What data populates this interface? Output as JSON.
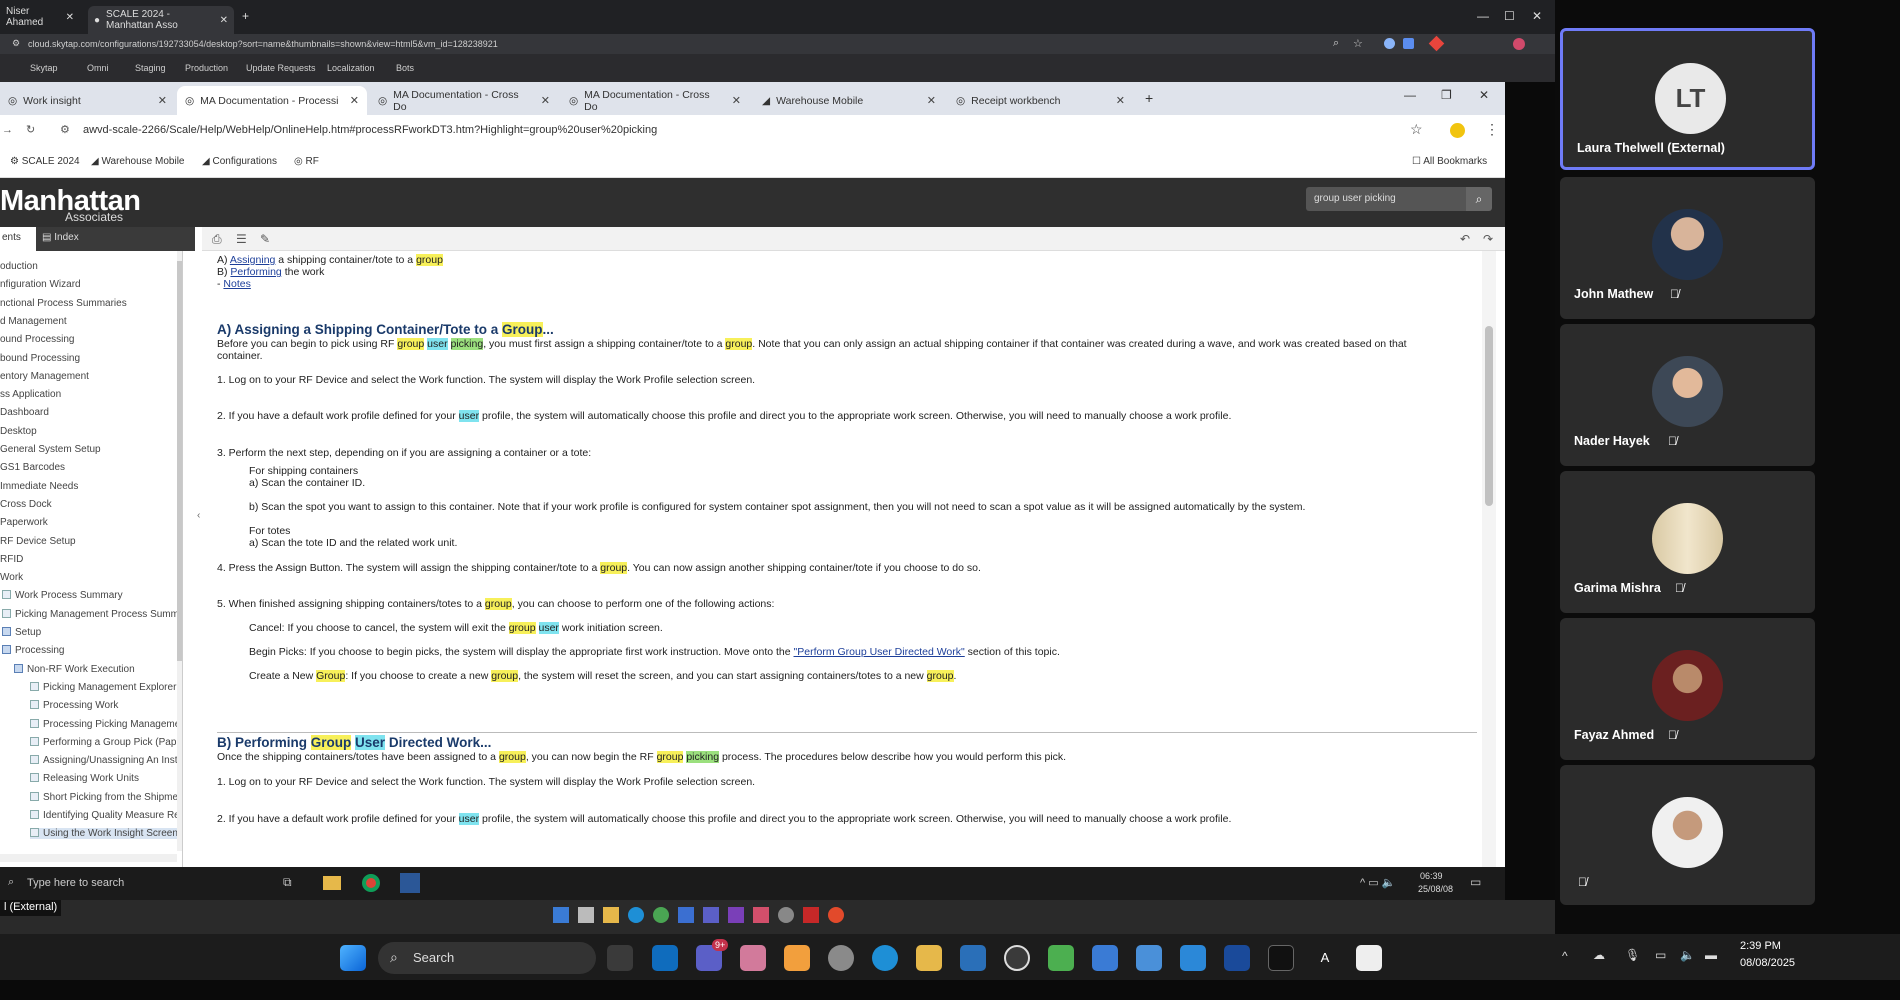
{
  "outer_browser": {
    "tabs": [
      {
        "label": "Niser Ahamed"
      },
      {
        "label": "SCALE 2024 - Manhattan Asso"
      }
    ],
    "url": "cloud.skytap.com/configurations/192733054/desktop?sort=name&thumbnails=shown&view=html5&vm_id=128238921",
    "bookmarks": [
      "Skytap",
      "Omni",
      "Staging",
      "Production",
      "Update Requests",
      "Localization",
      "Bots"
    ]
  },
  "inner_browser": {
    "tabs": [
      {
        "label": "Work insight"
      },
      {
        "label": "MA Documentation - Processi"
      },
      {
        "label": "MA Documentation - Cross Do"
      },
      {
        "label": "MA Documentation - Cross Do"
      },
      {
        "label": "Warehouse Mobile"
      },
      {
        "label": "Receipt workbench"
      }
    ],
    "url": "awvd-scale-2266/Scale/Help/WebHelp/OnlineHelp.htm#processRFworkDT3.htm?Highlight=group%20user%20picking",
    "bookmarks": [
      "SCALE 2024",
      "Warehouse Mobile",
      "Configurations",
      "RF"
    ],
    "all_bookmarks": "All Bookmarks"
  },
  "help": {
    "logo_main": "Manhattan",
    "logo_sub": "Associates",
    "search_value": "group user picking",
    "tab_contents": "ents",
    "tab_index": "Index",
    "toc": [
      {
        "label": "oduction",
        "type": "page"
      },
      {
        "label": "nfiguration Wizard",
        "type": "page"
      },
      {
        "label": "nctional Process Summaries",
        "type": "page"
      },
      {
        "label": "d Management",
        "type": "page"
      },
      {
        "label": "ound Processing",
        "type": "page"
      },
      {
        "label": "bound Processing",
        "type": "page"
      },
      {
        "label": "entory Management",
        "type": "page"
      },
      {
        "label": "ss Application",
        "type": "page"
      },
      {
        "label": "Dashboard",
        "type": "page"
      },
      {
        "label": "Desktop",
        "type": "page"
      },
      {
        "label": "General System Setup",
        "type": "page"
      },
      {
        "label": "GS1 Barcodes",
        "type": "page"
      },
      {
        "label": "Immediate Needs",
        "type": "page"
      },
      {
        "label": "Cross Dock",
        "type": "page"
      },
      {
        "label": "Paperwork",
        "type": "page"
      },
      {
        "label": "RF Device Setup",
        "type": "page"
      },
      {
        "label": "RFID",
        "type": "page"
      },
      {
        "label": "Work",
        "type": "page"
      },
      {
        "label": "Work Process Summary",
        "type": "leaf"
      },
      {
        "label": "Picking Management Process Summa",
        "type": "leaf"
      },
      {
        "label": "Setup",
        "type": "book"
      },
      {
        "label": "Processing",
        "type": "book"
      },
      {
        "label": "Non-RF Work Execution",
        "type": "book"
      },
      {
        "label": "Picking Management Explorer",
        "type": "leaf"
      },
      {
        "label": "Processing Work",
        "type": "leaf"
      },
      {
        "label": "Processing Picking Manageme",
        "type": "leaf"
      },
      {
        "label": "Performing a Group Pick (Pap",
        "type": "leaf"
      },
      {
        "label": "Assigning/Unassigning An Insti",
        "type": "leaf"
      },
      {
        "label": "Releasing Work Units",
        "type": "leaf"
      },
      {
        "label": "Short Picking from the Shipme",
        "type": "leaf"
      },
      {
        "label": "Identifying Quality Measure Re",
        "type": "leaf"
      },
      {
        "label": "Using the Work Insight Screen",
        "type": "leaf"
      }
    ]
  },
  "doc": {
    "top_lines": {
      "a_prefix": "A) ",
      "a_link": "Assigning",
      "a_text": " a shipping container/tote to a ",
      "a_hl": "group",
      "b_prefix": "B) ",
      "b_link": "Performing",
      "b_text": " the work",
      "c_prefix": "- ",
      "c_link": "Notes"
    },
    "sectionA": {
      "h_pre": "A) Assigning a Shipping Container/Tote to a ",
      "h_hl": "Group",
      "h_post": "...",
      "intro1_a": "Before you can begin to pick using RF ",
      "intro1_g": "group",
      "intro1_u": "user",
      "intro1_p": "picking",
      "intro1_b": ", you must first assign a shipping container/tote to a ",
      "intro1_g2": "group",
      "intro1_c": ". Note that you can only assign an actual shipping container if that container was created during a wave, and work was created based on that",
      "intro2": "container.",
      "s1": "1. Log on to your RF Device and select the Work function. The system will display the Work Profile selection screen.",
      "s2_a": "2. If you have a default work profile defined for your ",
      "s2_u": "user",
      "s2_b": " profile, the system will automatically choose this profile and direct you to the appropriate work screen. Otherwise, you will need to manually choose a work profile.",
      "s3": "3. Perform the next step, depending on if you are assigning a container or a tote:",
      "s3_ship": "For shipping containers",
      "s3_a": "a) Scan the container ID.",
      "s3_b": "b) Scan the spot you want to assign to this container. Note that if your work profile is configured for system container spot assignment, then you will not need to scan a spot value as it will be assigned automatically by the system.",
      "s3_tote": "For totes",
      "s3_ta": "a) Scan the tote ID and the related work unit.",
      "s4_a": "4. Press the Assign Button. The system will assign the shipping container/tote to a ",
      "s4_g": "group",
      "s4_b": ". You can now assign another shipping container/tote if you choose to do so.",
      "s5_a": "5. When finished assigning shipping containers/totes to a ",
      "s5_g": "group",
      "s5_b": ", you can choose to perform one of the following actions:",
      "cancel_a": "Cancel: If you choose to cancel, the system will exit the ",
      "cancel_g": "group",
      "cancel_u": "user",
      "cancel_b": " work initiation screen.",
      "begin_a": "Begin Picks: If you choose to begin picks, the system will display the appropriate first work instruction. Move onto the ",
      "begin_link": "\"Perform Group User Directed Work\"",
      "begin_b": " section of this topic.",
      "create_a": "Create a New ",
      "create_g": "Group",
      "create_b": ": If you choose to create a new ",
      "create_g2": "group",
      "create_c": ", the system will reset the screen, and you can start assigning containers/totes to a new ",
      "create_g3": "group",
      "create_d": "."
    },
    "sectionB": {
      "h_pre": "B) Performing ",
      "h_g": "Group",
      "h_u": "User",
      "h_post": " Directed Work...",
      "intro_a": "Once the shipping containers/totes have been assigned to a ",
      "intro_g": "group",
      "intro_b": ", you can now begin the RF ",
      "intro_g2": "group",
      "intro_p": "picking",
      "intro_c": " process. The procedures below describe how you would perform this pick.",
      "s1": "1. Log on to your RF Device and select the Work function. The system will display the Work Profile selection screen.",
      "s2_a": "2. If you have a default work profile defined for your ",
      "s2_u": "user",
      "s2_b": " profile, the system will automatically choose this profile and direct you to the appropriate work screen. Otherwise, you will need to manually choose a work profile."
    }
  },
  "remote_taskbar": {
    "search_placeholder": "Type here to search",
    "time": "06:39",
    "date": "25/08/08"
  },
  "shared_label": "l (External)",
  "participants": [
    {
      "name": "Laura Thelwell (External)",
      "initials": "LT",
      "muted": false,
      "active": true
    },
    {
      "name": "John Mathew",
      "muted": true
    },
    {
      "name": "Nader Hayek",
      "muted": true
    },
    {
      "name": "Garima Mishra",
      "muted": true
    },
    {
      "name": "Fayaz Ahmed",
      "muted": true
    },
    {
      "name": "",
      "muted": true
    }
  ],
  "taskbar": {
    "search_label": "Search",
    "time": "2:39 PM",
    "date": "08/08/2025",
    "badge": "9+"
  },
  "colors": {
    "accent": "#6f7bf7",
    "highlight_yellow": "#f7f05a",
    "highlight_cyan": "#7fe3ef",
    "highlight_green": "#9be07e"
  }
}
